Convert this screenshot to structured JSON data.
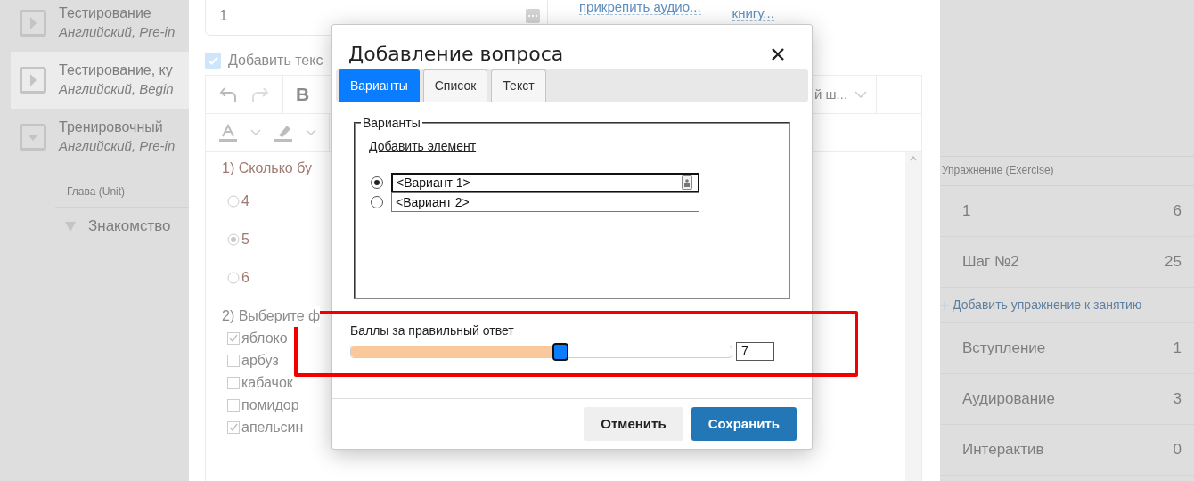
{
  "courses": [
    {
      "title": "Тестирование",
      "subtitle": "Английский, Pre-in",
      "expanded": false,
      "selected": false
    },
    {
      "title": "Тестирование, ку",
      "subtitle": "Английский, Begin",
      "expanded": false,
      "selected": true
    },
    {
      "title": "Тренировочный",
      "subtitle": "Английский, Pre-in",
      "expanded": true,
      "selected": false
    }
  ],
  "units": {
    "header": "Глава (Unit)",
    "items": [
      {
        "label": "Знакомство",
        "expanded": true
      }
    ]
  },
  "editor": {
    "number_field": {
      "value": "1"
    },
    "links": [
      "прикрепить аудио...",
      "книгу..."
    ],
    "add_text": {
      "label": "Добавить текс",
      "checked": true
    },
    "bold_button": "B",
    "font_select": "й ш...",
    "questions": [
      {
        "kind": "radio",
        "title": "1) Сколько бу",
        "options": [
          {
            "label": "4",
            "checked": false
          },
          {
            "label": "5",
            "checked": true
          },
          {
            "label": "6",
            "checked": false
          }
        ]
      },
      {
        "kind": "checkbox",
        "title": "2) Выберите ф",
        "options": [
          {
            "label": "яблоко",
            "checked": true
          },
          {
            "label": "арбуз",
            "checked": false
          },
          {
            "label": "кабачок",
            "checked": false
          },
          {
            "label": "помидор",
            "checked": false
          },
          {
            "label": "апельсин",
            "checked": true
          }
        ]
      }
    ]
  },
  "exercises": {
    "header": "Упражнение (Exercise)",
    "rows": [
      {
        "kind": "row",
        "label": "1",
        "count": "6"
      },
      {
        "kind": "row",
        "label": "Шаг №2",
        "count": "25"
      },
      {
        "kind": "add",
        "label": "Добавить упражнение к занятию"
      },
      {
        "kind": "row",
        "label": "Вступление",
        "count": "1"
      },
      {
        "kind": "row",
        "label": "Аудирование",
        "count": "3"
      },
      {
        "kind": "row",
        "label": "Интерактив",
        "count": "0"
      }
    ]
  },
  "dialog": {
    "title": "Добавление вопроса",
    "tabs": [
      {
        "label": "Варианты",
        "selected": true
      },
      {
        "label": "Список",
        "selected": false
      },
      {
        "label": "Текст",
        "selected": false
      }
    ],
    "fieldset": {
      "legend": "Варианты",
      "add_link": "Добавить элемент",
      "options": [
        {
          "text": "<Вариант 1>",
          "selected": true
        },
        {
          "text": "<Вариант 2>",
          "selected": false
        }
      ]
    },
    "score": {
      "label": "Баллы за правильный ответ",
      "level": 0.55,
      "value": "7",
      "highlighted": true
    },
    "buttons": [
      {
        "label": "Отменить",
        "kind": "secondary"
      },
      {
        "label": "Сохранить",
        "kind": "primary"
      }
    ]
  }
}
